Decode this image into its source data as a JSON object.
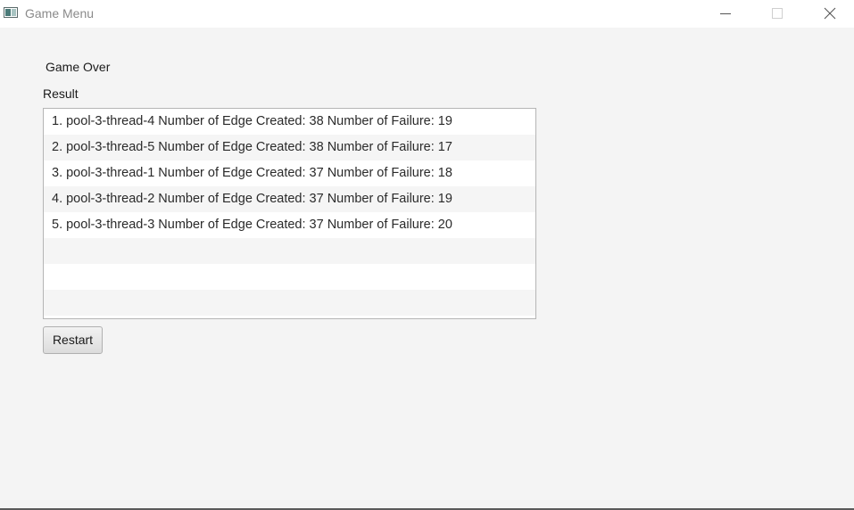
{
  "window": {
    "title": "Game Menu",
    "icon": "app-window-icon",
    "controls": [
      "minimize-icon",
      "maximize-icon",
      "close-icon"
    ]
  },
  "main": {
    "heading": "Game Over",
    "result_label": "Result",
    "results": [
      "1. pool-3-thread-4 Number of Edge Created: 38 Number of Failure: 19",
      "2. pool-3-thread-5 Number of Edge Created: 38 Number of Failure: 17",
      "3. pool-3-thread-1 Number of Edge Created: 37 Number of Failure: 18",
      "4. pool-3-thread-2 Number of Edge Created: 37 Number of Failure: 19",
      "5. pool-3-thread-3 Number of Edge Created: 37 Number of Failure: 20",
      "",
      "",
      ""
    ],
    "restart_label": "Restart"
  },
  "colors": {
    "background": "#f4f4f4",
    "titlebar": "#ffffff",
    "list_alt_row": "#f5f5f5",
    "list_border": "#b5b5b5"
  }
}
